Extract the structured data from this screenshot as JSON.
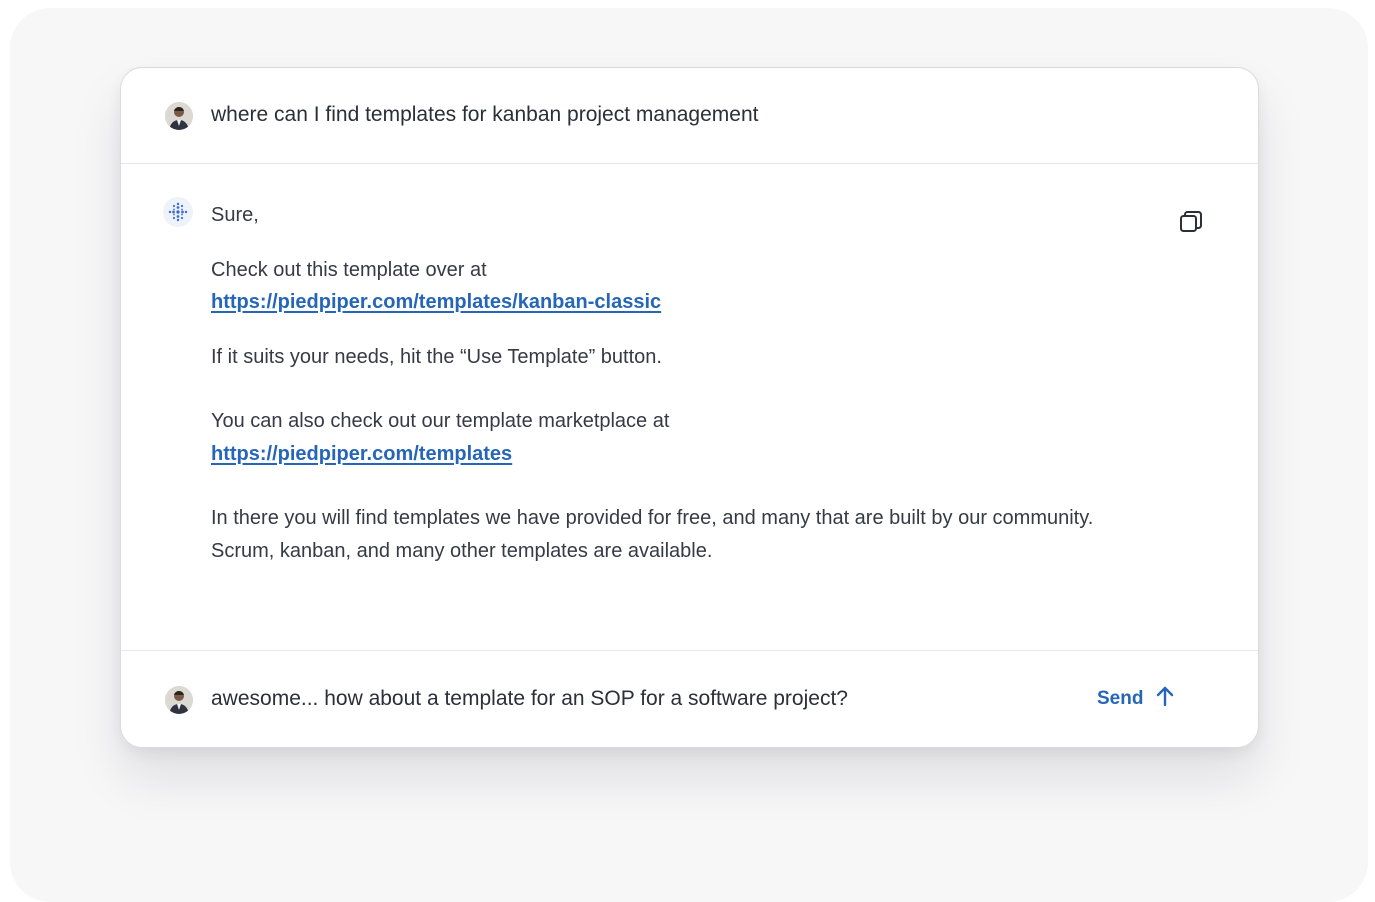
{
  "conversation": {
    "user_query": "where can I find templates for kanban project management",
    "answer": {
      "greeting": "Sure,",
      "intro": "Check out this template over at",
      "link1": "https://piedpiper.com/templates/kanban-classic",
      "instruction": "If it suits your needs, hit the “Use Template” button.",
      "marketplace_intro": "You can also check out our template marketplace at",
      "link2": "https://piedpiper.com/templates",
      "closing": "In there you will find templates we have provided for free, and many that are built by our community. Scrum, kanban, and many other templates are available."
    }
  },
  "composer": {
    "value": "awesome... how about a template for an SOP for a software project?",
    "send_label": "Send"
  },
  "icons": {
    "user_avatar": "user-avatar",
    "assistant_avatar": "assistant-dots-icon",
    "copy": "copy-icon",
    "send": "arrow-up-icon"
  },
  "colors": {
    "link": "#2566b8",
    "text": "#353a45",
    "border": "#e6e7eb"
  }
}
